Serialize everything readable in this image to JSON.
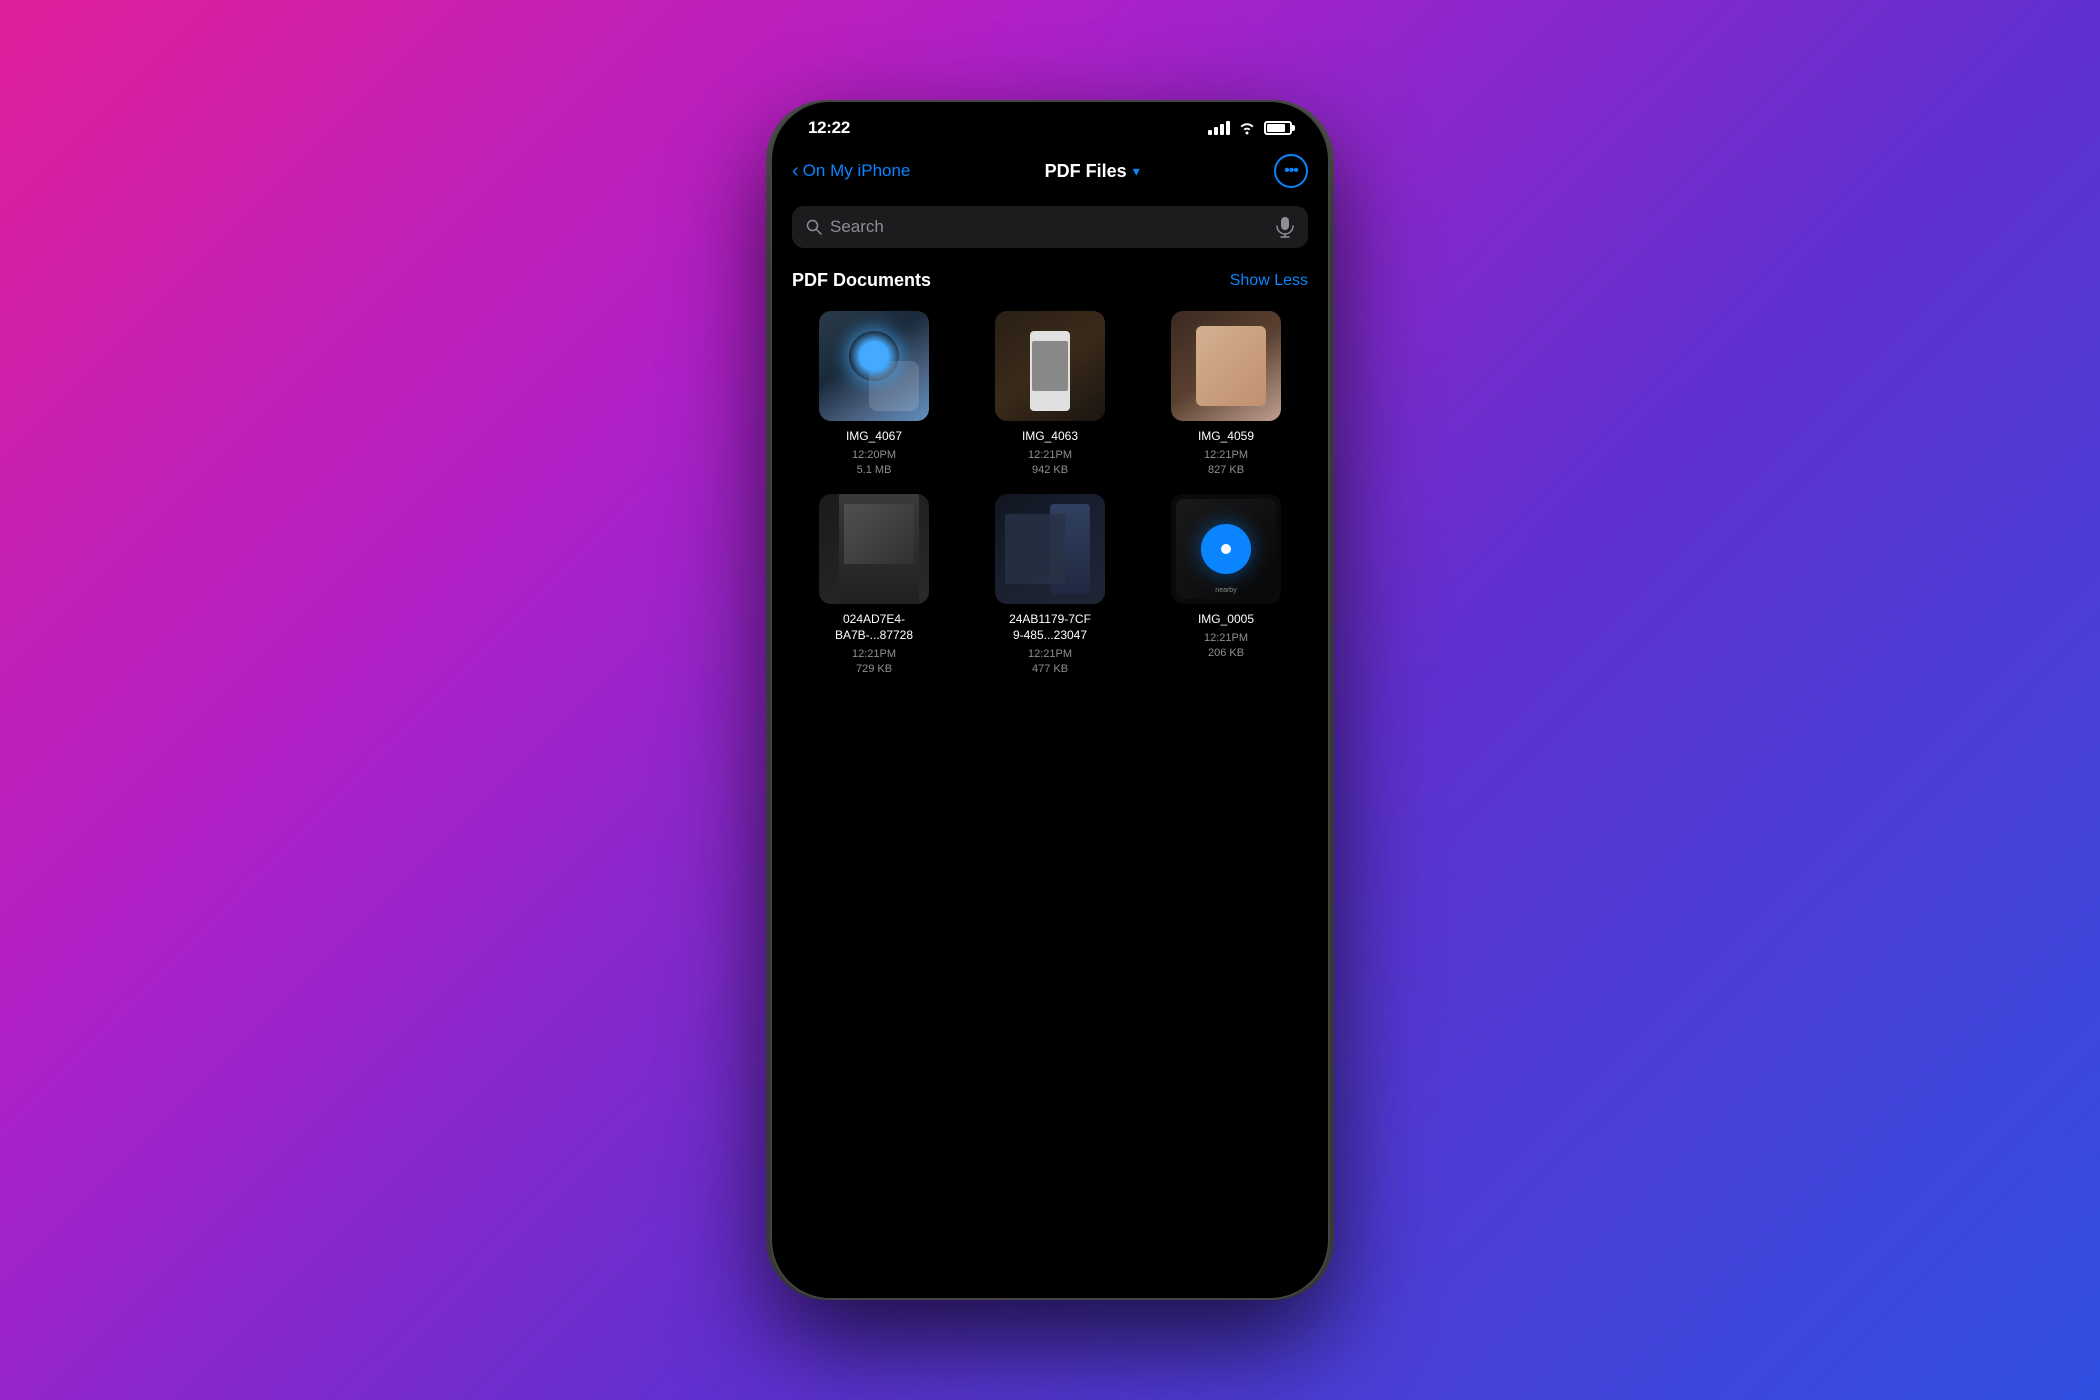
{
  "background": {
    "gradient": "linear-gradient(135deg, #e0209a 0%, #b020c8 30%, #6030d0 60%, #3050e0 100%)"
  },
  "status_bar": {
    "time": "12:22",
    "signal_label": "signal",
    "wifi_label": "wifi",
    "battery_label": "battery"
  },
  "nav": {
    "back_label": "On My iPhone",
    "title": "PDF Files",
    "chevron": "▾",
    "more_button_label": "•••"
  },
  "search": {
    "placeholder": "Search",
    "mic_label": "microphone"
  },
  "section": {
    "title": "PDF Documents",
    "show_less_label": "Show Less"
  },
  "files": [
    {
      "id": "img4067",
      "name": "IMG_4067",
      "time": "12:20PM",
      "size": "5.1 MB",
      "thumb_class": "thumb-img67"
    },
    {
      "id": "img4063",
      "name": "IMG_4063",
      "time": "12:21PM",
      "size": "942 KB",
      "thumb_class": "thumb-img63"
    },
    {
      "id": "img4059",
      "name": "IMG_4059",
      "time": "12:21PM",
      "size": "827 KB",
      "thumb_class": "thumb-img59"
    },
    {
      "id": "file024ad",
      "name": "024AD7E4-\nBA7B-...87728",
      "time": "12:21PM",
      "size": "729 KB",
      "thumb_class": "thumb-024ad"
    },
    {
      "id": "file24ab",
      "name": "24AB1179-7CF\n9-485...23047",
      "time": "12:21PM",
      "size": "477 KB",
      "thumb_class": "thumb-24ab"
    },
    {
      "id": "img0005",
      "name": "IMG_0005",
      "time": "12:21PM",
      "size": "206 KB",
      "thumb_class": "thumb-img0005"
    }
  ]
}
